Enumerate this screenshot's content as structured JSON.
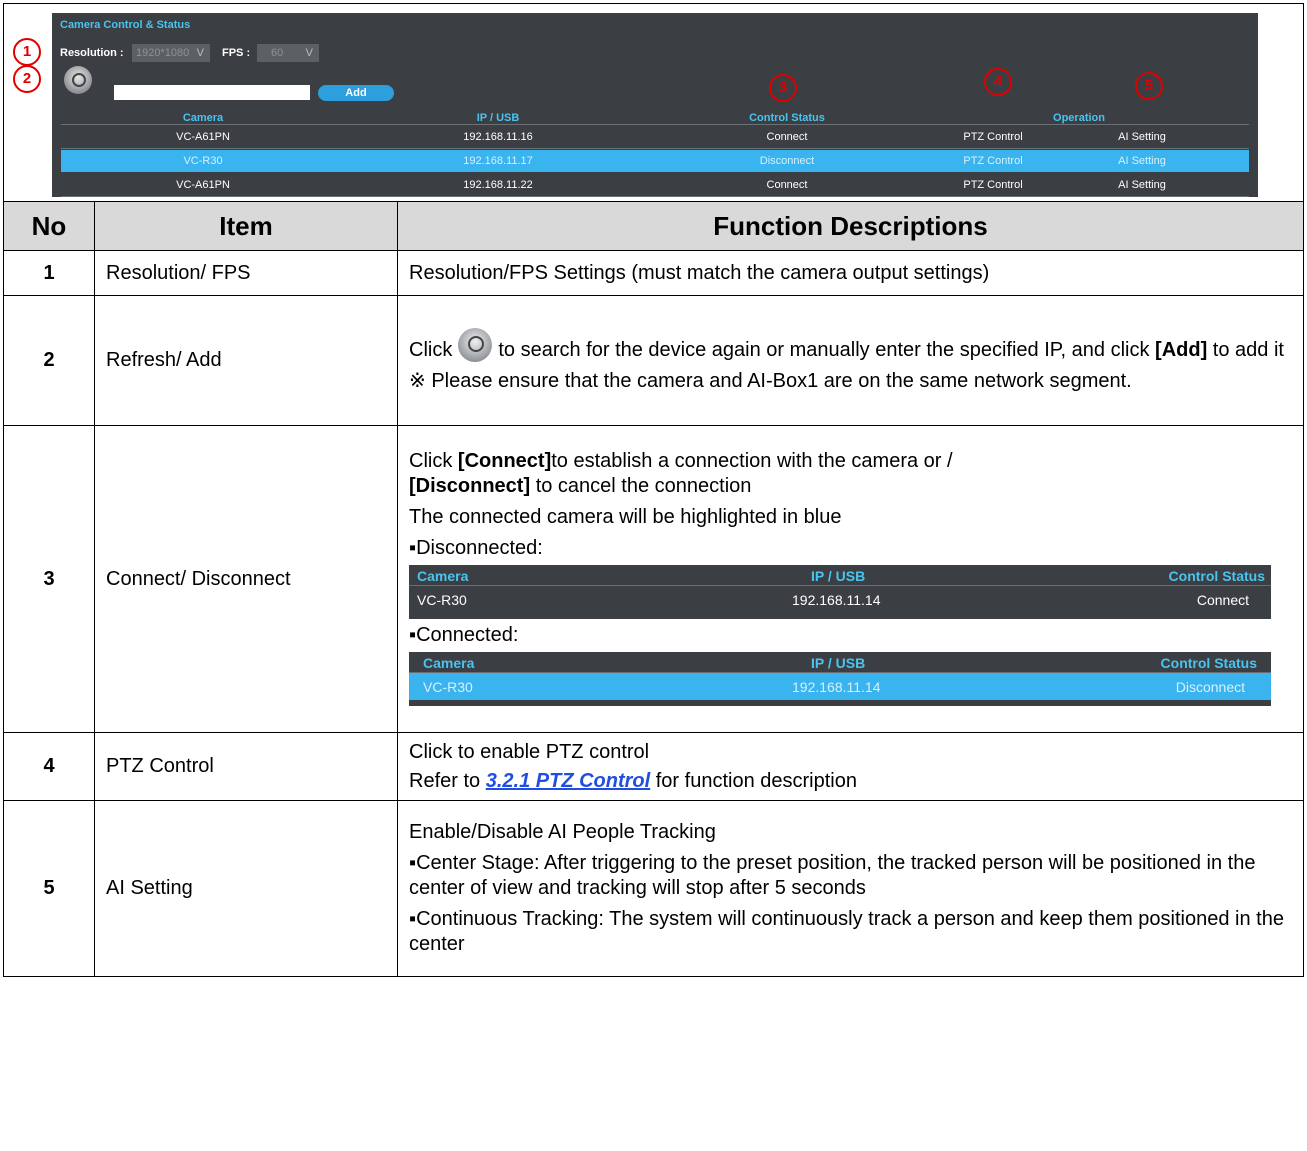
{
  "screenshot": {
    "title": "Camera Control & Status",
    "resolution_label": "Resolution :",
    "resolution_value": "1920*1080",
    "fps_label": "FPS :",
    "fps_value": "60",
    "add_label": "Add",
    "ip_input_value": "",
    "columns": {
      "camera": "Camera",
      "ip": "IP / USB",
      "status": "Control Status",
      "operation": "Operation"
    },
    "rows": [
      {
        "camera": "VC-A61PN",
        "ip": "192.168.11.16",
        "status": "Connect",
        "ptz": "PTZ Control",
        "ai": "AI Setting",
        "highlighted": false
      },
      {
        "camera": "VC-R30",
        "ip": "192.168.11.17",
        "status": "Disconnect",
        "ptz": "PTZ Control",
        "ai": "AI Setting",
        "highlighted": true
      },
      {
        "camera": "VC-A61PN",
        "ip": "192.168.11.22",
        "status": "Connect",
        "ptz": "PTZ Control",
        "ai": "AI Setting",
        "highlighted": false
      }
    ],
    "markers": [
      "1",
      "2",
      "3",
      "4",
      "5"
    ]
  },
  "table": {
    "headers": {
      "no": "No",
      "item": "Item",
      "desc": "Function Descriptions"
    },
    "rows": [
      {
        "no": "1",
        "item": "Resolution/ FPS",
        "desc": "Resolution/FPS Settings (must match the camera output settings)"
      },
      {
        "no": "2",
        "item": "Refresh/ Add",
        "desc_pre": "Click",
        "desc_post": "to search for the device again or manually enter the specified IP, and click",
        "desc_bold": "[Add]",
        "desc_end": "to add it",
        "note": "※ Please ensure that the camera and AI-Box1 are on the same network segment."
      },
      {
        "no": "3",
        "item": "Connect/ Disconnect",
        "p1_a": "Click",
        "p1_b": "[Connect]",
        "p1_c": "to establish a connection with the camera or /",
        "p1_d": "[Disconnect]",
        "p1_e": "to cancel the connection",
        "p2": "The connected camera will be highlighted in blue",
        "disconnected_label": "▪Disconnected:",
        "connected_label": "▪Connected:",
        "mini_disconnected": {
          "h_camera": "Camera",
          "h_ip": "IP / USB",
          "h_status": "Control Status",
          "camera": "VC-R30",
          "ip": "192.168.11.14",
          "status": "Connect"
        },
        "mini_connected": {
          "h_camera": "Camera",
          "h_ip": "IP / USB",
          "h_status": "Control Status",
          "camera": "VC-R30",
          "ip": "192.168.11.14",
          "status": "Disconnect"
        }
      },
      {
        "no": "4",
        "item": "PTZ Control",
        "p1": "Click to enable PTZ control",
        "p2_a": "Refer to",
        "p2_link": "3.2.1 PTZ Control",
        "p2_b": "for function description"
      },
      {
        "no": "5",
        "item": "AI Setting",
        "p1": "Enable/Disable AI People Tracking",
        "p2": "▪Center Stage: After triggering to the preset position, the tracked person will be positioned in the center of view and tracking will stop after 5 seconds",
        "p3": "▪Continuous Tracking: The system will continuously track a person and keep them positioned in the center"
      }
    ]
  },
  "colors": {
    "panel_bg": "#3b3e42",
    "accent_blue": "#49c4f0",
    "highlight_row": "#3ab4ee",
    "marker_red": "#e00000",
    "header_gray": "#d9d9d9",
    "link_blue": "#1f4ee0"
  }
}
